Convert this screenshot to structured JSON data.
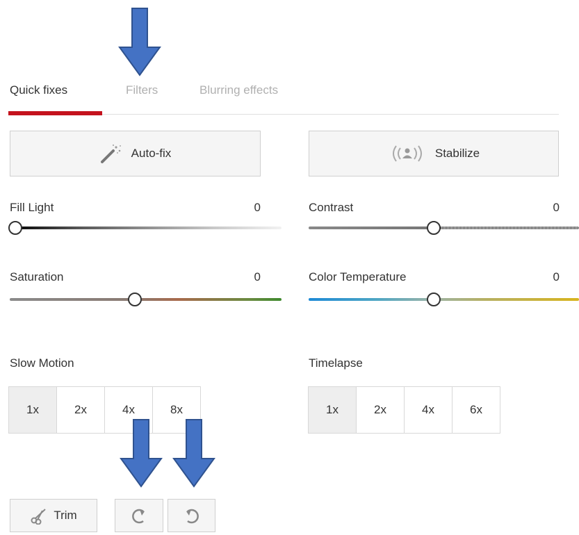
{
  "tabs": [
    {
      "label": "Quick fixes",
      "active": true
    },
    {
      "label": "Filters",
      "active": false
    },
    {
      "label": "Blurring effects",
      "active": false
    }
  ],
  "buttons": {
    "autofix": {
      "label": "Auto-fix",
      "icon": "magic-wand-icon"
    },
    "stabilize": {
      "label": "Stabilize",
      "icon": "stabilize-icon"
    }
  },
  "sliders": {
    "fill_light": {
      "label": "Fill Light",
      "value": "0"
    },
    "contrast": {
      "label": "Contrast",
      "value": "0"
    },
    "saturation": {
      "label": "Saturation",
      "value": "0"
    },
    "color_temperature": {
      "label": "Color Temperature",
      "value": "0"
    }
  },
  "slow_motion": {
    "label": "Slow Motion",
    "options": [
      "1x",
      "2x",
      "4x",
      "8x"
    ],
    "selected": "1x"
  },
  "timelapse": {
    "label": "Timelapse",
    "options": [
      "1x",
      "2x",
      "4x",
      "6x"
    ],
    "selected": "1x"
  },
  "bottom": {
    "trim_label": "Trim",
    "trim_icon": "scissors-icon",
    "rotate_right_icon": "rotate-right-icon",
    "rotate_left_icon": "rotate-left-icon"
  },
  "colors": {
    "accent": "#c4121d",
    "annotation_arrow": "#4472c4",
    "annotation_arrow_border": "#2f528f"
  }
}
